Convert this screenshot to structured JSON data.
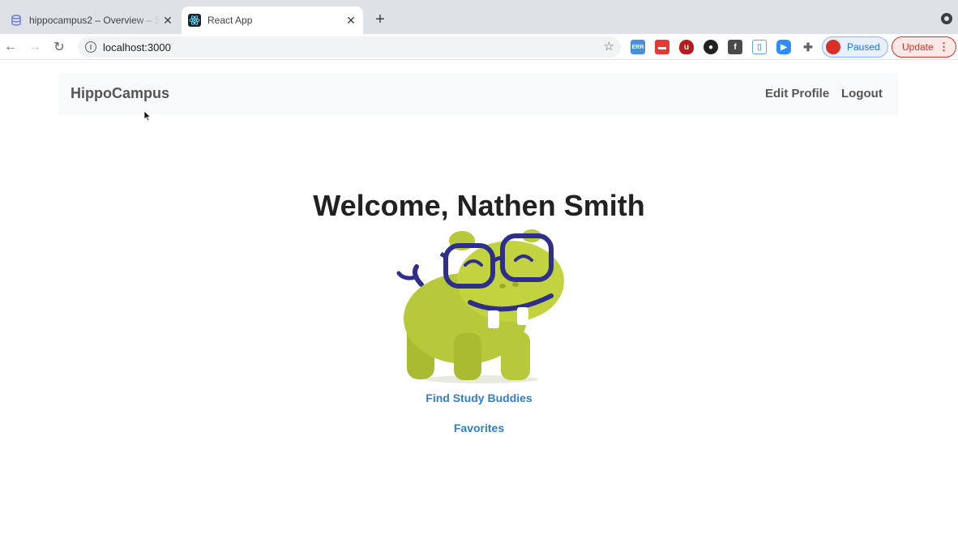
{
  "browser": {
    "tabs": [
      {
        "title": "hippocampus2 – Overview – S",
        "active": false
      },
      {
        "title": "React App",
        "active": true
      }
    ],
    "url": "localhost:3000",
    "profile_status": "Paused",
    "update_label": "Update"
  },
  "app": {
    "brand": "HippoCampus",
    "nav": {
      "edit_profile": "Edit Profile",
      "logout": "Logout"
    },
    "welcome": "Welcome, Nathen Smith",
    "links": {
      "find_buddies": "Find Study Buddies",
      "favorites": "Favorites"
    }
  },
  "colors": {
    "link": "#2f7fd1",
    "mascot_body": "#b7c93a",
    "mascot_glasses": "#2e2e8c"
  }
}
